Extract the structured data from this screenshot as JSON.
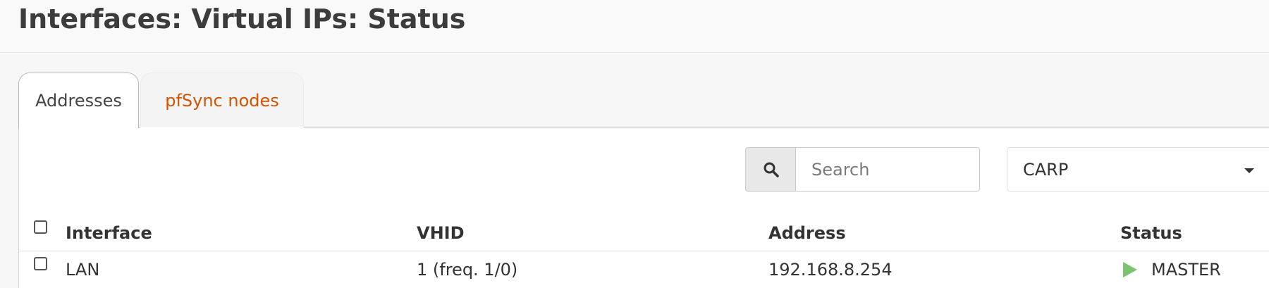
{
  "page": {
    "title": "Interfaces: Virtual IPs: Status"
  },
  "tabs": [
    {
      "label": "Addresses",
      "active": true
    },
    {
      "label": "pfSync nodes",
      "active": false
    }
  ],
  "search": {
    "icon": "search-icon",
    "placeholder": "Search",
    "value": ""
  },
  "type_filter": {
    "selected": "CARP",
    "icon": "caret-down-icon"
  },
  "table": {
    "columns": [
      "Interface",
      "VHID",
      "Address",
      "Status"
    ],
    "rows": [
      {
        "checked": false,
        "interface": "LAN",
        "vhid": "1 (freq. 1/0)",
        "address": "192.168.8.254",
        "status": "MASTER",
        "status_icon": "play-icon",
        "status_color": "#7dc370"
      }
    ]
  },
  "colors": {
    "link": "#d35400",
    "text": "#333333",
    "master": "#7dc370"
  }
}
